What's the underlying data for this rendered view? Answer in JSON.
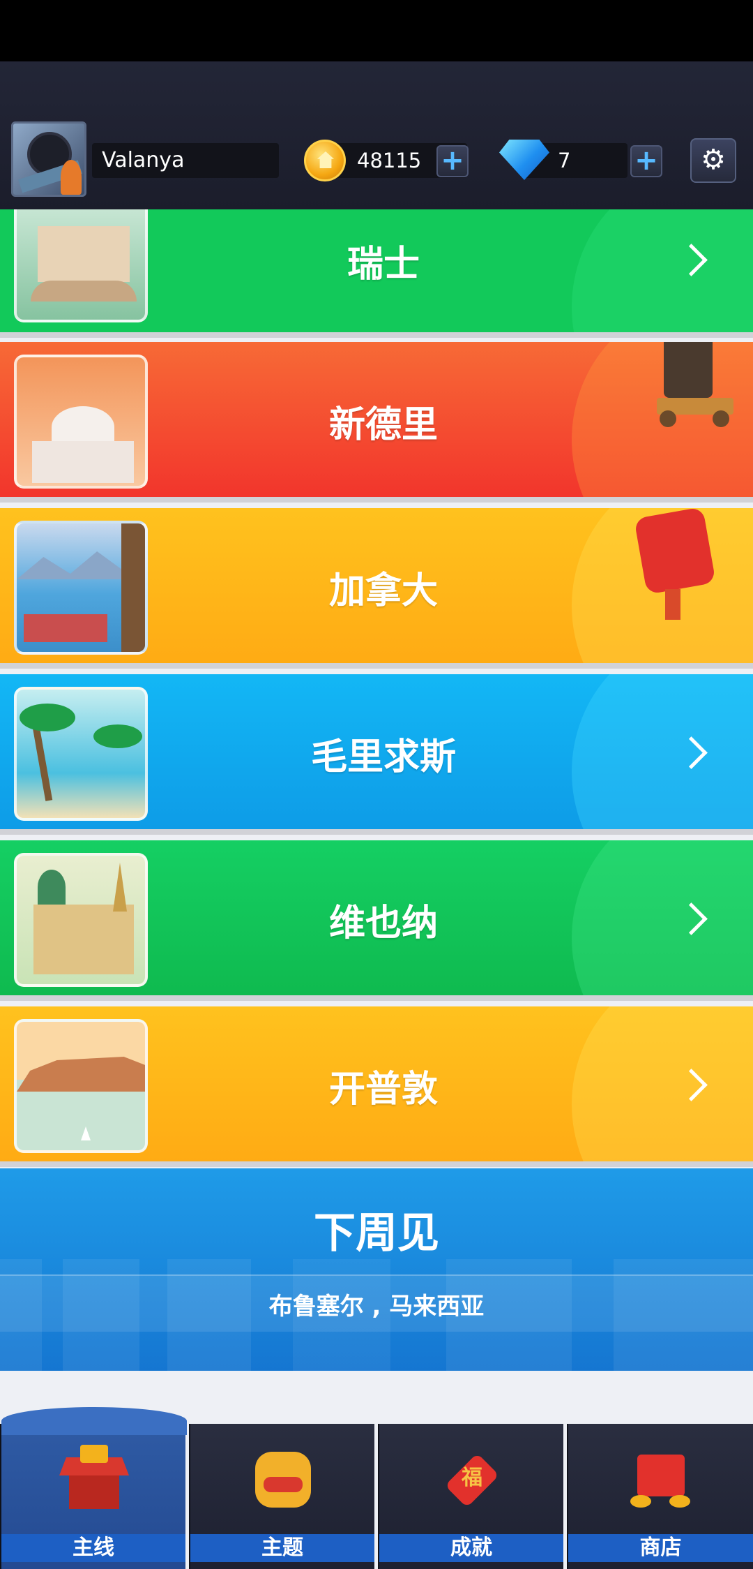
{
  "header": {
    "username": "Valanya",
    "coins": "48115",
    "gems": "7",
    "plus": "+"
  },
  "levels": [
    {
      "title": "瑞士",
      "color": "#12c95a",
      "bottom_cut": true
    },
    {
      "title": "新德里",
      "color": "#f4452f"
    },
    {
      "title": "加拿大",
      "color": "#ffb818"
    },
    {
      "title": "毛里求斯",
      "color": "#10aaf0"
    },
    {
      "title": "维也纳",
      "color": "#12c95a"
    },
    {
      "title": "开普敦",
      "color": "#ffb818"
    }
  ],
  "next_week": {
    "title": "下周见",
    "subtitle": "布鲁塞尔 , 马来西亚"
  },
  "tabs": [
    {
      "label": "主线",
      "icon": "pagoda-icon",
      "active": true
    },
    {
      "label": "主题",
      "icon": "lion-dance-icon",
      "active": false
    },
    {
      "label": "成就",
      "icon": "fu-lantern-icon",
      "active": false
    },
    {
      "label": "商店",
      "icon": "red-envelope-icon",
      "active": false
    }
  ]
}
